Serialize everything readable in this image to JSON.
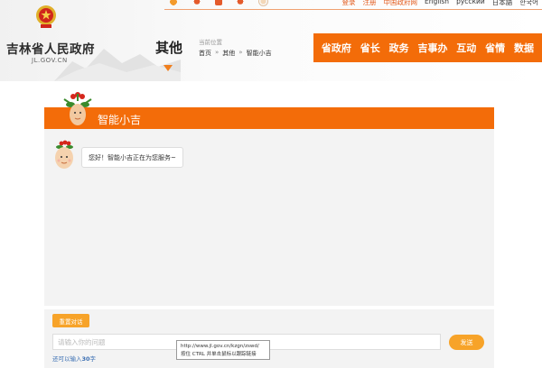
{
  "site": {
    "name": "吉林省人民政府",
    "domain": "JL.GOV.CN"
  },
  "top_links": {
    "login": "登录",
    "register": "注册",
    "china_gov": "中国政府网",
    "english": "English",
    "russian": "русский",
    "japanese": "日本語",
    "korean": "한국어"
  },
  "section": {
    "title": "其他"
  },
  "breadcrumb": {
    "label": "当前位置",
    "items": [
      "首页",
      "其他",
      "智能小吉"
    ]
  },
  "nav": {
    "items": [
      "省政府",
      "省长",
      "政务",
      "吉事办",
      "互动",
      "省情",
      "数据"
    ]
  },
  "chat": {
    "title": "智能小吉",
    "greeting": "您好！智能小吉正在为您服务~"
  },
  "input": {
    "reset_label": "重置对话",
    "placeholder": "请输入你的问题",
    "send_label": "发送",
    "count_prefix": "还可以输入",
    "count_value": "30",
    "count_suffix": "字"
  },
  "tooltip": {
    "url": "http://www.jl.gov.cn/kzgn/zswd/",
    "hint": "按住 CTRL 并单击鼠标以跟踪链接"
  },
  "colors": {
    "brand_orange": "#f36c09",
    "button_orange": "#f7a329",
    "link_blue": "#3b6fb3"
  }
}
